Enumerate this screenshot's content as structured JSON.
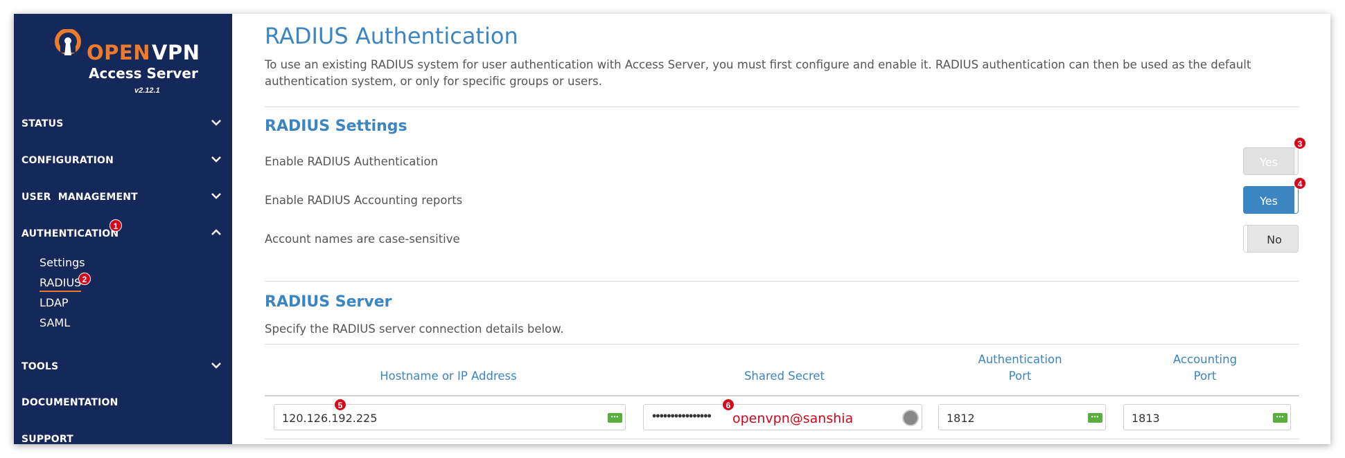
{
  "sidebar": {
    "logo": {
      "brand_open": "OPEN",
      "brand_vpn": "VPN",
      "subtitle": "Access Server",
      "version": "v2.12.1"
    },
    "items": [
      {
        "label": "STATUS",
        "expanded": false
      },
      {
        "label": "CONFIGURATION",
        "expanded": false
      },
      {
        "label": "USER  MANAGEMENT",
        "expanded": false
      },
      {
        "label": "AUTHENTICATION",
        "expanded": true,
        "badge": "1"
      },
      {
        "label": "TOOLS",
        "expanded": false
      },
      {
        "label": "DOCUMENTATION"
      },
      {
        "label": "SUPPORT"
      }
    ],
    "auth_subitems": [
      {
        "label": "Settings"
      },
      {
        "label": "RADIUS",
        "active": true,
        "badge": "2"
      },
      {
        "label": "LDAP"
      },
      {
        "label": "SAML"
      }
    ]
  },
  "main": {
    "title": "RADIUS Authentication",
    "description": "To use an existing RADIUS system for user authentication with Access Server, you must first configure and enable it. RADIUS authentication can then be used as the default authentication system, or only for specific groups or users.",
    "settings_section": {
      "title": "RADIUS Settings",
      "rows": [
        {
          "label": "Enable RADIUS Authentication",
          "toggle": "Yes",
          "state": "disabled",
          "badge": "3"
        },
        {
          "label": "Enable RADIUS Accounting reports",
          "toggle": "Yes",
          "state": "on",
          "badge": "4"
        },
        {
          "label": "Account names are case-sensitive",
          "toggle": "No",
          "state": "off"
        }
      ]
    },
    "server_section": {
      "title": "RADIUS Server",
      "description": "Specify the RADIUS server connection details below.",
      "columns": [
        "Hostname or IP Address",
        "Shared Secret",
        "Authentication\nPort",
        "Accounting\nPort"
      ],
      "row": {
        "hostname": "120.126.192.225",
        "hostname_badge": "5",
        "secret_masked": "••••••••••••••••",
        "secret_badge": "6",
        "secret_annotation": "openvpn@sanshia",
        "auth_port": "1812",
        "acct_port": "1813"
      }
    }
  },
  "colors": {
    "sidebar_bg": "#14295a",
    "accent": "#3b86c2",
    "brand_orange": "#ee7a2b",
    "badge_red": "#d4081c"
  }
}
